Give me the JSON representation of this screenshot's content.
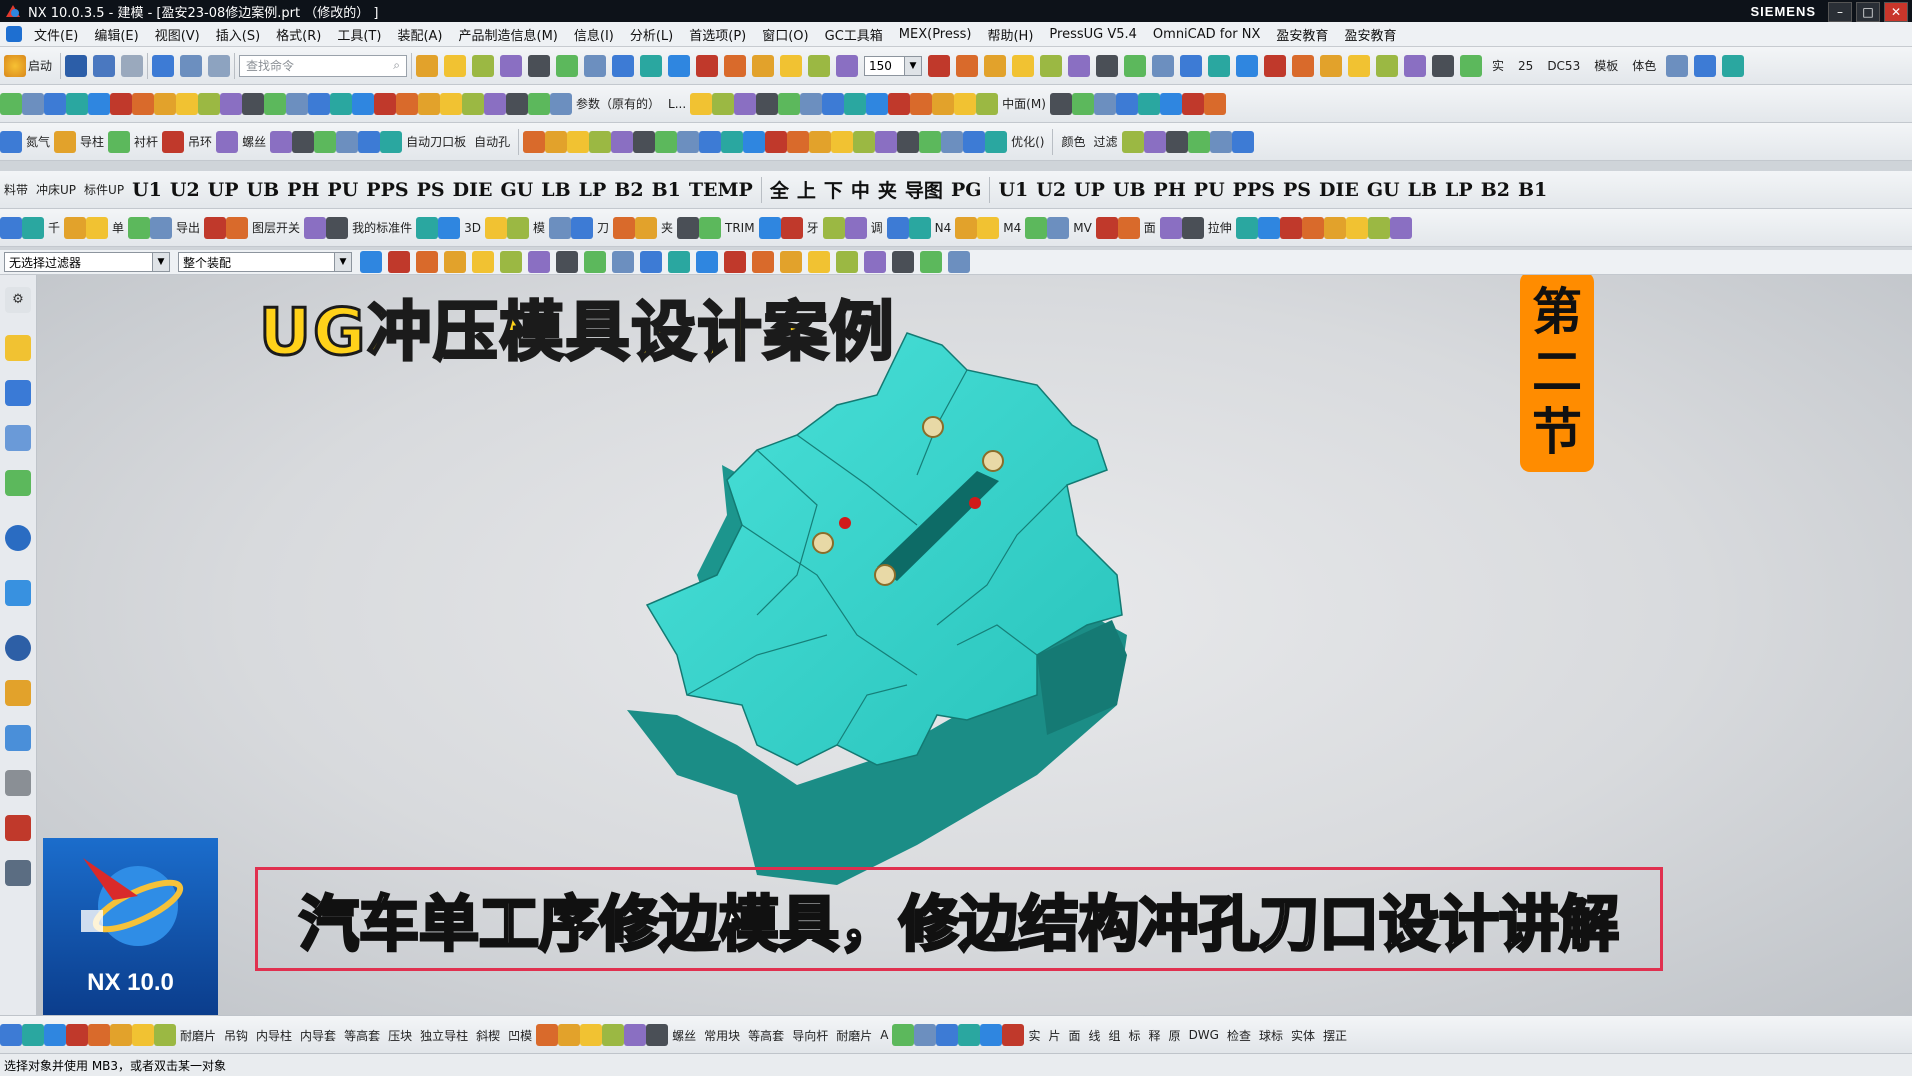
{
  "window": {
    "title": "NX 10.0.3.5 - 建模 - [盈安23-08修边案例.prt （修改的） ]",
    "brand": "SIEMENS",
    "buttons": [
      "–",
      "□",
      "✕"
    ]
  },
  "menu": [
    "文件(E)",
    "编辑(E)",
    "视图(V)",
    "插入(S)",
    "格式(R)",
    "工具(T)",
    "装配(A)",
    "产品制造信息(M)",
    "信息(I)",
    "分析(L)",
    "首选项(P)",
    "窗口(O)",
    "GC工具箱",
    "MEX(Press)",
    "帮助(H)",
    "PressUG V5.4",
    "OmniCAD for NX",
    "盈安教育",
    "盈安教育"
  ],
  "toolbar1": {
    "start_label": "启动",
    "search_placeholder": "查找命令",
    "zoom_value": "150",
    "labels": [
      "实",
      "25",
      "DC53",
      "模板",
      "体色"
    ]
  },
  "toolbar2": {
    "labels": [
      "参数（原有的）",
      "L...",
      "中面(M)"
    ]
  },
  "toolbar3": {
    "labels": [
      "氮气",
      "导柱",
      "衬杆",
      "吊环",
      "螺丝",
      "自动刀口板",
      "自动孔",
      "优化()",
      "颜色",
      "过滤"
    ]
  },
  "toolbar4": {
    "labels": [
      "料带",
      "冲床UP",
      "标件UP",
      "U1",
      "U2",
      "UP",
      "UB",
      "PH",
      "PU",
      "PPS",
      "PS",
      "DIE",
      "GU",
      "LB",
      "LP",
      "B2",
      "B1",
      "TEMP",
      "全",
      "上",
      "下",
      "中",
      "夹",
      "导图",
      "PG",
      "U1",
      "U2",
      "UP",
      "UB",
      "PH",
      "PU",
      "PPS",
      "PS",
      "DIE",
      "GU",
      "LB",
      "LP",
      "B2",
      "B1"
    ]
  },
  "toolbar5": {
    "labels": [
      "千",
      "单",
      "导出",
      "图层开关",
      "我的标准件",
      "3D",
      "模",
      "刀",
      "夹",
      "TRIM",
      "牙",
      "调",
      "N4",
      "M4",
      "MV",
      "面",
      "拉伸"
    ]
  },
  "filterbar": {
    "filter_value": "无选择过滤器",
    "assembly_value": "整个装配"
  },
  "overlay": {
    "title": "UG冲压模具设计案例",
    "badge": [
      "第",
      "二",
      "节"
    ],
    "subtitle": "汽车单工序修边模具，修边结构冲孔刀口设计讲解",
    "logo_text": "NX 10.0"
  },
  "bottombar": {
    "labels": [
      "耐磨片",
      "吊钩",
      "内导柱",
      "内导套",
      "等高套",
      "压块",
      "独立导柱",
      "斜楔",
      "凹模",
      "螺丝",
      "常用块",
      "等高套",
      "导向杆",
      "耐磨片",
      "A",
      "实",
      "片",
      "面",
      "线",
      "组",
      "标",
      "释",
      "原",
      "DWG",
      "检查",
      "球标",
      "实体",
      "摆正"
    ]
  },
  "status": {
    "text": "选择对象并使用 MB3，或者双击某一对象"
  },
  "colors": {
    "model": "#33d1c9",
    "title_yellow": "#ffd21a",
    "badge_orange": "#ff8c00",
    "frame_red": "#e0304f"
  }
}
